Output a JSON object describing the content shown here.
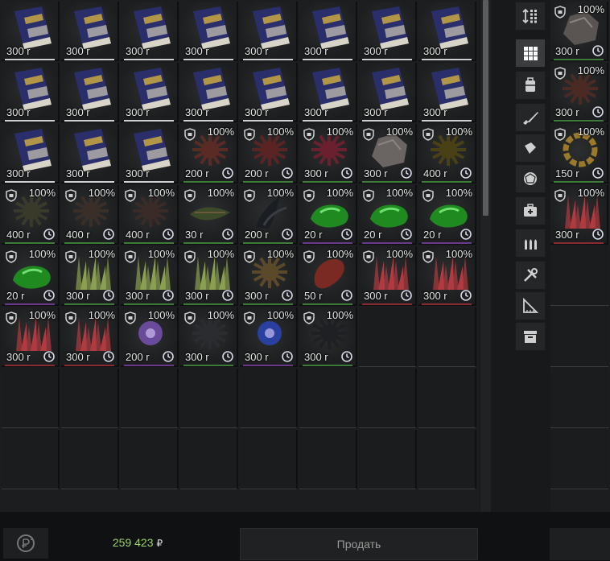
{
  "grid": {
    "rows": [
      [
        {
          "kind": "book",
          "price": "300 r"
        },
        {
          "kind": "book",
          "price": "300 r"
        },
        {
          "kind": "book",
          "price": "300 r"
        },
        {
          "kind": "book",
          "price": "300 r"
        },
        {
          "kind": "book",
          "price": "300 r"
        },
        {
          "kind": "book",
          "price": "300 r"
        },
        {
          "kind": "book",
          "price": "300 r"
        },
        {
          "kind": "book",
          "price": "300 r"
        }
      ],
      [
        {
          "kind": "book",
          "price": "300 r"
        },
        {
          "kind": "book",
          "price": "300 r"
        },
        {
          "kind": "book",
          "price": "300 r"
        },
        {
          "kind": "book",
          "price": "300 r"
        },
        {
          "kind": "book",
          "price": "300 r"
        },
        {
          "kind": "book",
          "price": "300 r"
        },
        {
          "kind": "book",
          "price": "300 r"
        },
        {
          "kind": "book",
          "price": "300 r"
        }
      ],
      [
        {
          "kind": "book",
          "price": "300 r"
        },
        {
          "kind": "book",
          "price": "300 r"
        },
        {
          "kind": "book",
          "price": "300 r"
        },
        {
          "kind": "dark-flower",
          "price": "200 r",
          "pct": "100%",
          "tint": "#5a2a24"
        },
        {
          "kind": "dark-flower",
          "price": "200 r",
          "pct": "100%",
          "tint": "#5a2424"
        },
        {
          "kind": "dark-flower",
          "price": "300 r",
          "pct": "100%",
          "tint": "#6b2030"
        },
        {
          "kind": "rock",
          "price": "300 r",
          "pct": "100%",
          "tint": "#6a6462"
        },
        {
          "kind": "spiky",
          "price": "400 r",
          "pct": "100%",
          "tint": "#4a4015"
        }
      ],
      [
        {
          "kind": "spiky",
          "price": "400 r",
          "pct": "100%",
          "tint": "#3a3a2a"
        },
        {
          "kind": "spiky",
          "price": "400 r",
          "pct": "100%",
          "tint": "#3a2e28"
        },
        {
          "kind": "spiky",
          "price": "400 r",
          "pct": "100%",
          "tint": "#3a2a28"
        },
        {
          "kind": "branch",
          "price": "30 r",
          "pct": "100%",
          "tint": "#3c4a2a"
        },
        {
          "kind": "claw",
          "price": "200 r",
          "pct": "100%",
          "tint": "#1a1e22"
        },
        {
          "kind": "slime",
          "price": "20 r",
          "pct": "100%",
          "tint": "#1f8a1f"
        },
        {
          "kind": "slime",
          "price": "20 r",
          "pct": "100%",
          "tint": "#1f8a1f"
        },
        {
          "kind": "slime",
          "price": "20 r",
          "pct": "100%",
          "tint": "#1f8a1f"
        }
      ],
      [
        {
          "kind": "slime",
          "price": "20 r",
          "pct": "100%",
          "tint": "#1f8a1f"
        },
        {
          "kind": "crystal",
          "price": "300 r",
          "pct": "100%",
          "tint": "#8aa050"
        },
        {
          "kind": "crystal",
          "price": "300 r",
          "pct": "100%",
          "tint": "#8aa050"
        },
        {
          "kind": "crystal",
          "price": "300 r",
          "pct": "100%",
          "tint": "#8aa050"
        },
        {
          "kind": "spiky",
          "price": "300 r",
          "pct": "100%",
          "tint": "#5a4a2a"
        },
        {
          "kind": "meat",
          "price": "50 r",
          "pct": "100%",
          "tint": "#7a2a22"
        },
        {
          "kind": "crystal",
          "price": "300 r",
          "pct": "100%",
          "tint": "#b03a40"
        },
        {
          "kind": "crystal",
          "price": "300 r",
          "pct": "100%",
          "tint": "#b03a40"
        }
      ],
      [
        {
          "kind": "crystal",
          "price": "300 r",
          "pct": "100%",
          "tint": "#b03a40"
        },
        {
          "kind": "crystal",
          "price": "300 r",
          "pct": "100%",
          "tint": "#b03a40"
        },
        {
          "kind": "orb",
          "price": "200 r",
          "pct": "100%",
          "tint": "#6a4a9a"
        },
        {
          "kind": "spiky",
          "price": "300 r",
          "pct": "100%",
          "tint": "#2a2c30"
        },
        {
          "kind": "orb",
          "price": "300 r",
          "pct": "100%",
          "tint": "#2a40a0"
        },
        {
          "kind": "spiky",
          "price": "300 r",
          "pct": "100%",
          "tint": "#1e2024"
        }
      ]
    ]
  },
  "trader": {
    "items": [
      {
        "kind": "rock",
        "price": "300 r",
        "pct": "100%",
        "tint": "#5a5452"
      },
      {
        "kind": "dark-flower",
        "price": "300 r",
        "pct": "100%",
        "tint": "#4a2a22"
      },
      {
        "kind": "ring",
        "price": "150 r",
        "pct": "100%",
        "tint": "#9a7a2a"
      },
      {
        "kind": "crystal",
        "price": "300 r",
        "pct": "100%",
        "tint": "#b03a40"
      }
    ]
  },
  "categories": [
    {
      "icon": "sort-icon",
      "active": false
    },
    {
      "icon": "grid-icon",
      "active": true
    },
    {
      "icon": "backpack-icon",
      "active": false
    },
    {
      "icon": "rifle-icon",
      "active": false
    },
    {
      "icon": "armor-icon",
      "active": false
    },
    {
      "icon": "artifact-icon",
      "active": false
    },
    {
      "icon": "medkit-icon",
      "active": false
    },
    {
      "icon": "ammo-icon",
      "active": false
    },
    {
      "icon": "tools-icon",
      "active": false
    },
    {
      "icon": "ruler-icon",
      "active": false
    },
    {
      "icon": "box-icon",
      "active": false
    }
  ],
  "footer": {
    "money": "259 423",
    "currency": "₽",
    "sell_label": "Продать"
  },
  "colors": {
    "money_green": "#9ad066",
    "underline_white": "#cfcfcf",
    "underline_green": "#3f7a3a",
    "underline_purple": "#6a3a8a",
    "underline_red": "#8a2a32"
  }
}
